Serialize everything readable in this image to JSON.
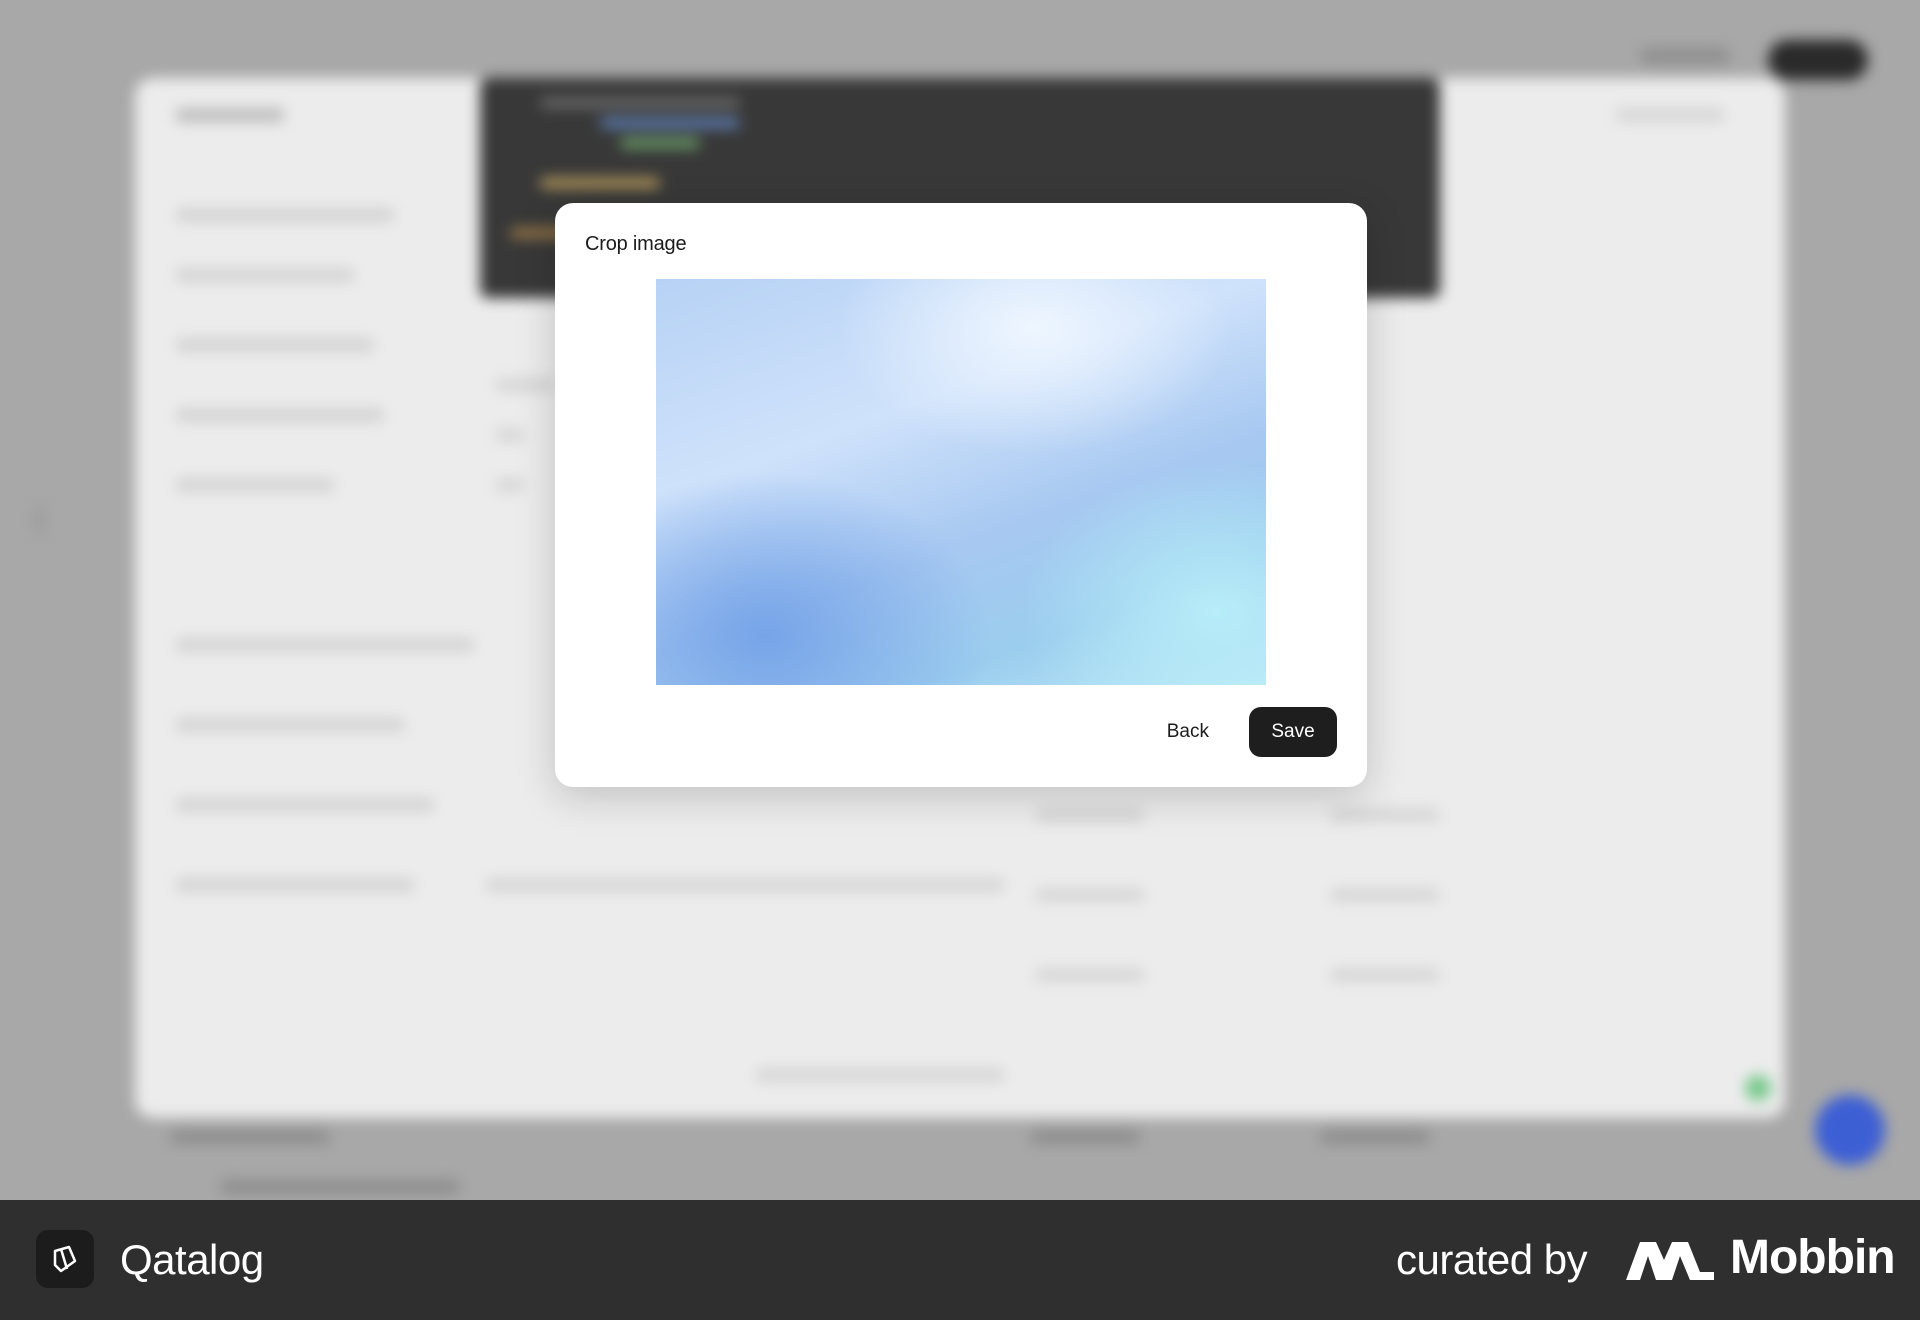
{
  "modal": {
    "title": "Crop image",
    "back_label": "Back",
    "save_label": "Save",
    "crop_image_colors": [
      "#cfe2fb",
      "#76a4e8",
      "#b7ecf8"
    ]
  },
  "footer": {
    "brand_name": "Qatalog",
    "curated_label": "curated by",
    "curator_name": "Mobbin"
  },
  "icons": {
    "brand": "qatalog-logo-icon",
    "curator": "mobbin-logo-icon"
  },
  "colors": {
    "backdrop": "#a6a6a6",
    "modal_bg": "#ffffff",
    "primary_button": "#1e1e1e",
    "footer_bg": "#2f2f2f",
    "fab": "#3d5fd4"
  }
}
